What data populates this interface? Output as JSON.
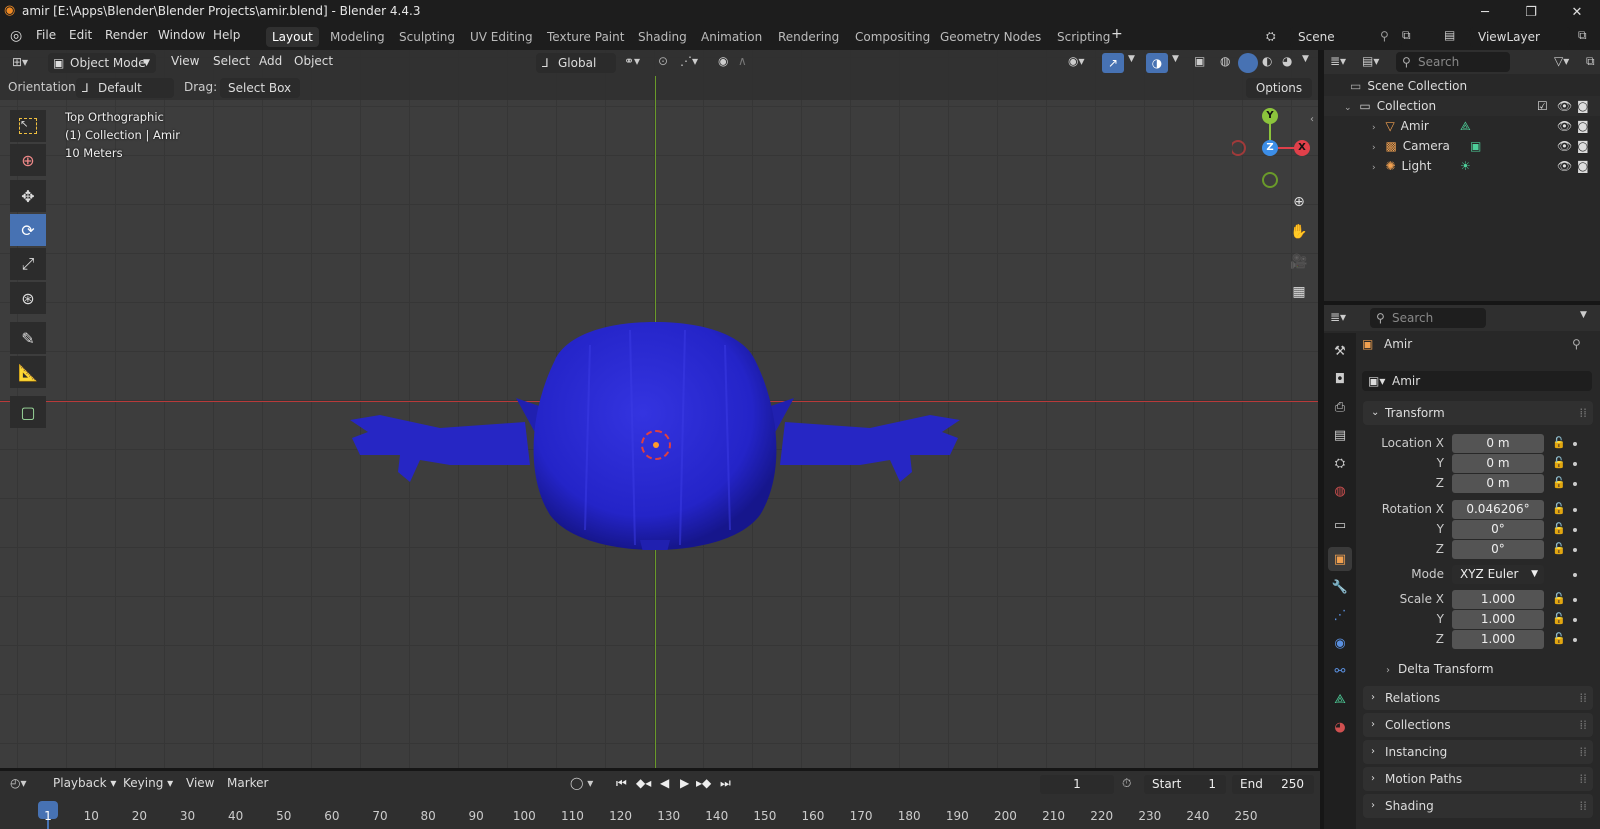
{
  "window": {
    "title": "amir [E:\\Apps\\Blender\\Blender Projects\\amir.blend] - Blender 4.4.3",
    "minimize": "─",
    "maximize": "❐",
    "close": "✕"
  },
  "menu": {
    "file": "File",
    "edit": "Edit",
    "render": "Render",
    "window": "Window",
    "help": "Help"
  },
  "workspaces": [
    "Layout",
    "Modeling",
    "Sculpting",
    "UV Editing",
    "Texture Paint",
    "Shading",
    "Animation",
    "Rendering",
    "Compositing",
    "Geometry Nodes",
    "Scripting"
  ],
  "add_workspace": "+",
  "scene": {
    "name": "Scene",
    "view_layer": "ViewLayer"
  },
  "viewport_header": {
    "mode": "Object Mode",
    "view": "View",
    "select": "Select",
    "add": "Add",
    "object": "Object",
    "transform_orientation": "Global"
  },
  "tool_settings": {
    "orientation_label": "Orientation:",
    "orientation_value": "Default",
    "drag_label": "Drag:",
    "drag_value": "Select Box",
    "options": "Options"
  },
  "viewport_info": {
    "view_name": "Top Orthographic",
    "collection": "(1) Collection | Amir",
    "scale": "10 Meters"
  },
  "gizmo": {
    "y": "Y",
    "z": "Z",
    "x": "X"
  },
  "outliner": {
    "search_placeholder": "Search",
    "scene_collection": "Scene Collection",
    "collection": "Collection",
    "objects": [
      "Amir",
      "Camera",
      "Light"
    ]
  },
  "properties": {
    "search_placeholder": "Search",
    "object_name": "Amir",
    "object_field": "Amir",
    "transform_panel": "Transform",
    "location_x_label": "Location X",
    "location_x": "0 m",
    "location_y_label": "Y",
    "location_y": "0 m",
    "location_z_label": "Z",
    "location_z": "0 m",
    "rotation_x_label": "Rotation X",
    "rotation_x": "0.046206°",
    "rotation_y_label": "Y",
    "rotation_y": "0°",
    "rotation_z_label": "Z",
    "rotation_z": "0°",
    "mode_label": "Mode",
    "mode_value": "XYZ Euler",
    "scale_x_label": "Scale X",
    "scale_x": "1.000",
    "scale_y_label": "Y",
    "scale_y": "1.000",
    "scale_z_label": "Z",
    "scale_z": "1.000",
    "delta_transform": "Delta Transform",
    "panels": [
      "Relations",
      "Collections",
      "Instancing",
      "Motion Paths",
      "Shading"
    ]
  },
  "timeline": {
    "playback": "Playback",
    "keying": "Keying",
    "view": "View",
    "marker": "Marker",
    "current_frame": "1",
    "start_label": "Start",
    "start": "1",
    "end_label": "End",
    "end": "250",
    "ruler": [
      "1",
      "10",
      "20",
      "30",
      "40",
      "50",
      "60",
      "70",
      "80",
      "90",
      "100",
      "110",
      "120",
      "130",
      "140",
      "150",
      "160",
      "170",
      "180",
      "190",
      "200",
      "210",
      "220",
      "230",
      "240",
      "250"
    ]
  },
  "colors": {
    "accent": "#4772b3",
    "mesh": "#2a2ad6",
    "x_axis": "#e0404a",
    "y_axis": "#8cc43c",
    "z_axis": "#3c8ee8"
  }
}
